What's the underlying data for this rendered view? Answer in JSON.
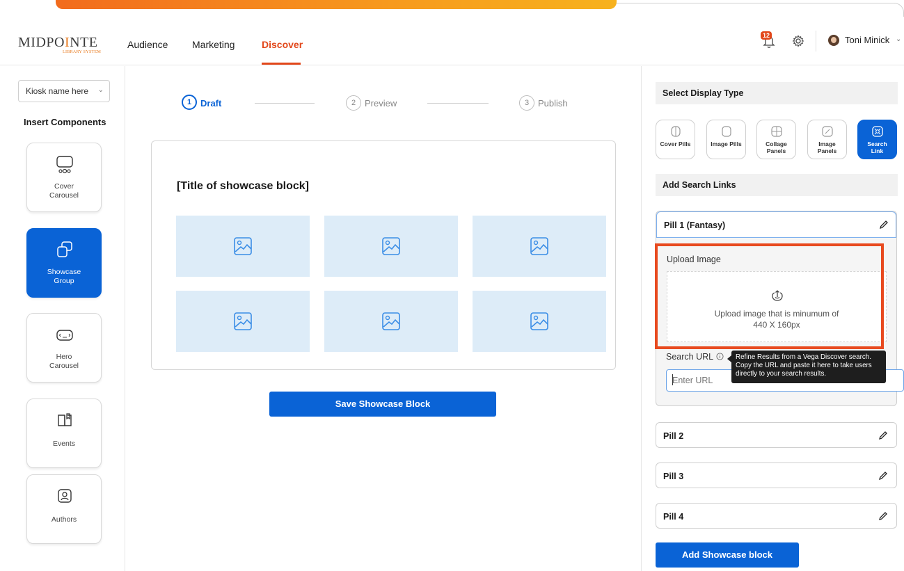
{
  "header": {
    "logo_text_1": "MIDPO",
    "logo_text_2": "NTE",
    "logo_sub": "LIBRARY SYSTEM",
    "nav": [
      "Audience",
      "Marketing",
      "Discover"
    ],
    "active_nav": "Discover",
    "notification_count": "12",
    "user_name": "Toni Minick"
  },
  "sidebar": {
    "kiosk_select": "Kiosk name here",
    "insert_title": "Insert Components",
    "components": [
      {
        "label": "Cover Carousel",
        "icon": "cover-carousel-icon",
        "active": false
      },
      {
        "label": "Showcase Group",
        "icon": "showcase-group-icon",
        "active": true
      },
      {
        "label": "Hero Carousel",
        "icon": "hero-carousel-icon",
        "active": false
      },
      {
        "label": "Events",
        "icon": "book-icon",
        "active": false
      },
      {
        "label": "Authors",
        "icon": "author-icon",
        "active": false
      }
    ]
  },
  "stepper": [
    {
      "num": "1",
      "label": "Draft",
      "active": true
    },
    {
      "num": "2",
      "label": "Preview",
      "active": false
    },
    {
      "num": "3",
      "label": "Publish",
      "active": false
    }
  ],
  "canvas": {
    "title": "[Title of showcase block]",
    "tile_icon": "image-placeholder-icon"
  },
  "save_button": "Save Showcase Block",
  "right_panel": {
    "display_type_title": "Select Display Type",
    "display_types": [
      {
        "label": "Cover Pills",
        "active": false
      },
      {
        "label": "Image Pills",
        "active": false
      },
      {
        "label": "Collage Panels",
        "active": false
      },
      {
        "label": "Image Panels",
        "active": false
      },
      {
        "label": "Search Link",
        "active": true
      }
    ],
    "search_links_title": "Add Search Links",
    "pill1": {
      "title": "Pill 1 (Fantasy)",
      "upload_label": "Upload Image",
      "upload_text_1": "Upload image that is minumum of",
      "upload_text_2": "440 X 160px",
      "search_url_label": "Search URL",
      "url_placeholder": "Enter URL",
      "tooltip": "Refine Results from a Vega Discover search. Copy the URL and paste it here to take users directly to your search results."
    },
    "pills": [
      "Pill 2",
      "Pill 3",
      "Pill 4"
    ],
    "add_button": "Add Showcase block"
  },
  "colors": {
    "accent_blue": "#0a63d6",
    "accent_orange": "#e2471a",
    "highlight_red": "#e84a1f"
  }
}
